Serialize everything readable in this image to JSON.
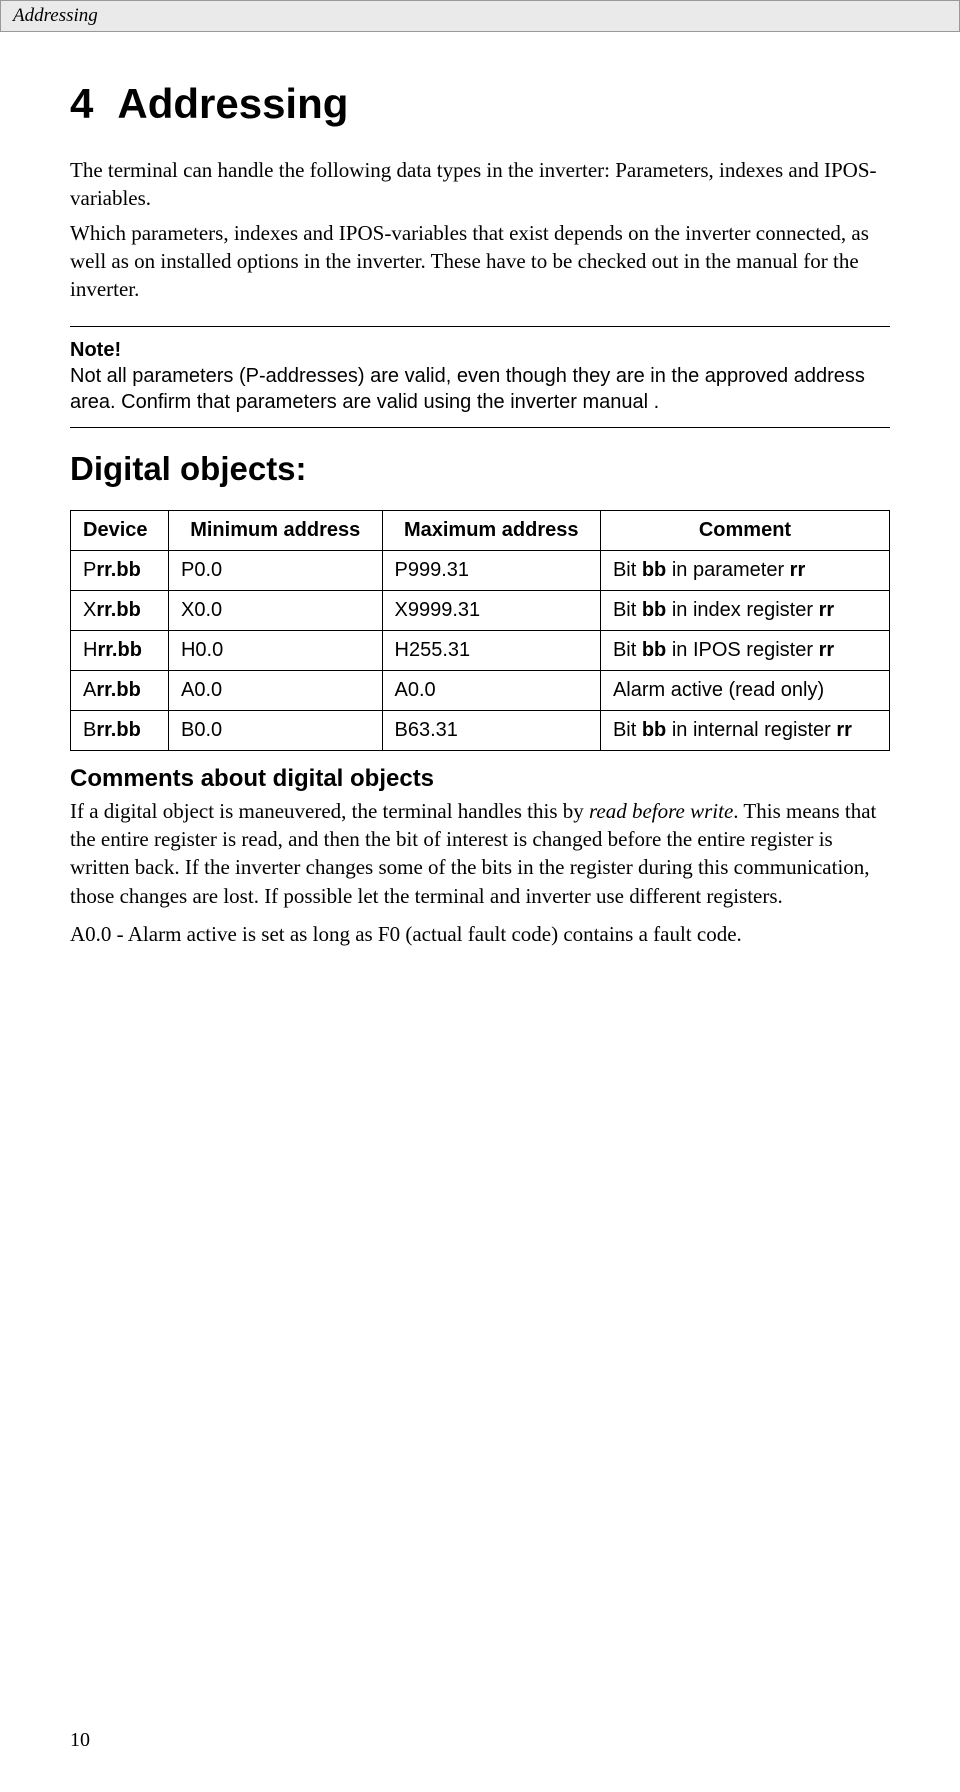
{
  "header": {
    "running_title": "Addressing"
  },
  "chapter": {
    "number": "4",
    "title": "Addressing"
  },
  "intro": {
    "para1": "The terminal can handle the following data types in the inverter: Parameters, indexes and IPOS-variables.",
    "para2": "Which parameters, indexes and IPOS-variables that exist depends on the inverter connected, as well as on installed options in the inverter. These have to be checked out in the manual for the inverter."
  },
  "note": {
    "label": "Note!",
    "text": "Not all parameters (P-addresses) are valid, even though they are in the approved address area. Confirm that parameters are valid using the inverter manual ."
  },
  "section": {
    "heading": "Digital objects:"
  },
  "table": {
    "headers": [
      "Device",
      "Minimum address",
      "Maximum address",
      "Comment"
    ],
    "rows": [
      {
        "device_pre": "P",
        "device_suf": "rr.bb",
        "min": "P0.0",
        "max": "P999.31",
        "comment_pre": "Bit ",
        "comment_b": "bb",
        "comment_post": " in parameter ",
        "comment_b2": "rr",
        "comment_tail": ""
      },
      {
        "device_pre": "X",
        "device_suf": "rr.bb",
        "min": "X0.0",
        "max": "X9999.31",
        "comment_pre": "Bit ",
        "comment_b": "bb",
        "comment_post": " in index register ",
        "comment_b2": "rr",
        "comment_tail": ""
      },
      {
        "device_pre": "H",
        "device_suf": "rr.bb",
        "min": "H0.0",
        "max": "H255.31",
        "comment_pre": "Bit ",
        "comment_b": "bb",
        "comment_post": " in IPOS register ",
        "comment_b2": "rr",
        "comment_tail": ""
      },
      {
        "device_pre": "A",
        "device_suf": "rr.bb",
        "min": "A0.0",
        "max": "A0.0",
        "comment_pre": "Alarm active (read only)",
        "comment_b": "",
        "comment_post": "",
        "comment_b2": "",
        "comment_tail": ""
      },
      {
        "device_pre": "B",
        "device_suf": "rr.bb",
        "min": "B0.0",
        "max": "B63.31",
        "comment_pre": "Bit ",
        "comment_b": "bb",
        "comment_post": " in internal register ",
        "comment_b2": "rr",
        "comment_tail": ""
      }
    ]
  },
  "comments": {
    "heading": "Comments about digital objects",
    "para1_pre": "If a digital object is maneuvered, the terminal handles this by ",
    "para1_em": "read before write",
    "para1_post": ". This means that the entire register is read, and then the bit of interest is changed before the entire register is written back. If the inverter changes some of the bits in the register during this communication, those changes are lost. If possible let the terminal and inverter use different registers.",
    "para2": "A0.0 - Alarm active is set as long as F0 (actual fault code) contains a fault code."
  },
  "page_number": "10"
}
